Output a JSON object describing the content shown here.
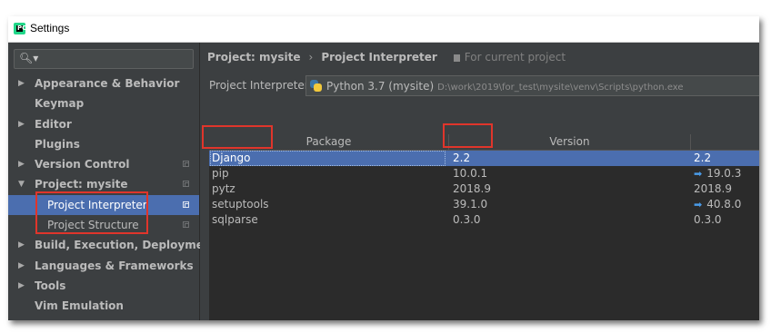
{
  "window": {
    "title": "Settings"
  },
  "sidebar": {
    "search_placeholder": "",
    "items": [
      {
        "label": "Appearance & Behavior",
        "expandable": true
      },
      {
        "label": "Keymap",
        "expandable": false
      },
      {
        "label": "Editor",
        "expandable": true
      },
      {
        "label": "Plugins",
        "expandable": false
      },
      {
        "label": "Version Control",
        "expandable": true
      },
      {
        "label": "Project: mysite",
        "expandable": true,
        "expanded": true
      },
      {
        "label": "Project Interpreter",
        "child": true,
        "selected": true
      },
      {
        "label": "Project Structure",
        "child": true
      },
      {
        "label": "Build, Execution, Deployment",
        "expandable": true
      },
      {
        "label": "Languages & Frameworks",
        "expandable": true
      },
      {
        "label": "Tools",
        "expandable": true
      },
      {
        "label": "Vim Emulation",
        "expandable": false
      }
    ]
  },
  "main": {
    "breadcrumb": {
      "project": "Project: mysite",
      "separator": "›",
      "page": "Project Interpreter",
      "note": "For current project"
    },
    "interpreter": {
      "label": "Project Interpreter:",
      "name": "Python 3.7 (mysite)",
      "path": "D:\\work\\2019\\for_test\\mysite\\venv\\Scripts\\python.exe"
    },
    "table": {
      "columns": [
        "Package",
        "Version",
        ""
      ],
      "rows": [
        {
          "package": "Django",
          "version": "2.2",
          "latest": "2.2",
          "upgrade": false
        },
        {
          "package": "pip",
          "version": "10.0.1",
          "latest": "19.0.3",
          "upgrade": true
        },
        {
          "package": "pytz",
          "version": "2018.9",
          "latest": "2018.9",
          "upgrade": false
        },
        {
          "package": "setuptools",
          "version": "39.1.0",
          "latest": "40.8.0",
          "upgrade": true
        },
        {
          "package": "sqlparse",
          "version": "0.3.0",
          "latest": "0.3.0",
          "upgrade": false
        }
      ]
    }
  },
  "icons": {
    "search": "search-icon",
    "expand": "expand-arrow-icon",
    "upgrade": "upgrade-arrow-icon",
    "python": "python-icon"
  },
  "colors": {
    "selection": "#4b6eaf",
    "highlight_box": "#e0352b",
    "upgrade_arrow": "#4a9be8"
  }
}
